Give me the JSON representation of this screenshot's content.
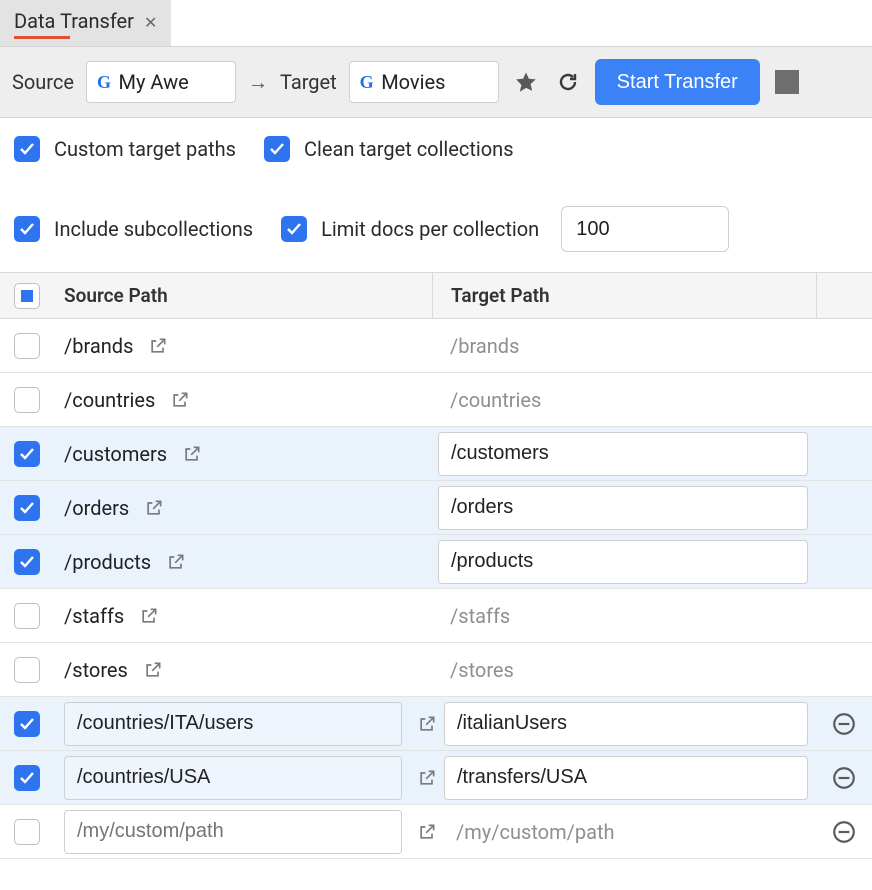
{
  "tab": {
    "title": "Data Transfer"
  },
  "toolbar": {
    "source_label": "Source",
    "target_label": "Target",
    "source_value": "My Awe",
    "target_value": "Movies",
    "start_label": "Start Transfer"
  },
  "options": {
    "custom_target_paths": {
      "label": "Custom target paths",
      "checked": true
    },
    "clean_target": {
      "label": "Clean target collections",
      "checked": true
    },
    "include_subcollections": {
      "label": "Include subcollections",
      "checked": true
    },
    "limit_docs": {
      "label": "Limit docs per collection",
      "checked": true,
      "value": "100"
    }
  },
  "table": {
    "header": {
      "source": "Source Path",
      "target": "Target Path"
    },
    "rows": [
      {
        "selected": false,
        "source": "/brands",
        "target": "/brands",
        "editable_source": false,
        "editable_target": false,
        "removable": false
      },
      {
        "selected": false,
        "source": "/countries",
        "target": "/countries",
        "editable_source": false,
        "editable_target": false,
        "removable": false
      },
      {
        "selected": true,
        "source": "/customers",
        "target": "/customers",
        "editable_source": false,
        "editable_target": true,
        "removable": false
      },
      {
        "selected": true,
        "source": "/orders",
        "target": "/orders",
        "editable_source": false,
        "editable_target": true,
        "removable": false
      },
      {
        "selected": true,
        "source": "/products",
        "target": "/products",
        "editable_source": false,
        "editable_target": true,
        "removable": false
      },
      {
        "selected": false,
        "source": "/staffs",
        "target": "/staffs",
        "editable_source": false,
        "editable_target": false,
        "removable": false
      },
      {
        "selected": false,
        "source": "/stores",
        "target": "/stores",
        "editable_source": false,
        "editable_target": false,
        "removable": false
      },
      {
        "selected": true,
        "source": "/countries/ITA/users",
        "target": "/italianUsers",
        "editable_source": true,
        "editable_target": true,
        "removable": true
      },
      {
        "selected": true,
        "source": "/countries/USA",
        "target": "/transfers/USA",
        "editable_source": true,
        "editable_target": true,
        "removable": true
      },
      {
        "selected": false,
        "source": "",
        "target": "",
        "editable_source": true,
        "editable_target": false,
        "removable": true,
        "source_placeholder": "/my/custom/path",
        "target_placeholder": "/my/custom/path"
      }
    ]
  }
}
